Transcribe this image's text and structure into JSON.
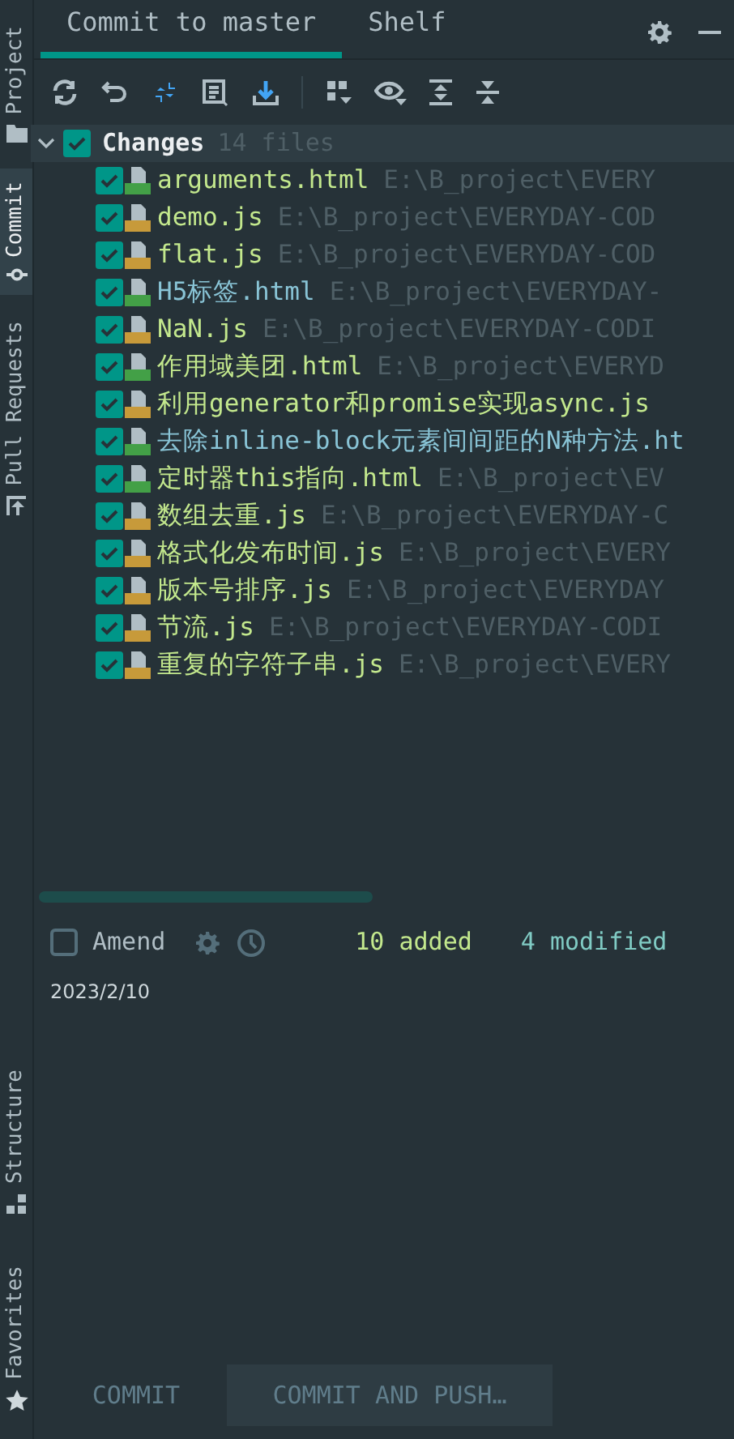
{
  "side_tabs": [
    {
      "label": "Project",
      "kind": "folder",
      "selected": false
    },
    {
      "label": "Commit",
      "kind": "commit",
      "selected": true
    },
    {
      "label": "Pull Requests",
      "kind": "pull",
      "selected": false
    }
  ],
  "side_tabs_bottom": [
    {
      "label": "Structure",
      "kind": "structure",
      "selected": false
    },
    {
      "label": "Favorites",
      "kind": "star",
      "selected": false
    }
  ],
  "tabs": [
    {
      "label": "Commit to master",
      "selected": true
    },
    {
      "label": "Shelf",
      "selected": false
    }
  ],
  "changes": {
    "label": "Changes",
    "count": "14 files",
    "checked": true,
    "expanded": true,
    "files": [
      {
        "name": "arguments.html",
        "path": "E:\\B_project\\EVERY",
        "kind": "html",
        "modified": false,
        "checked": true
      },
      {
        "name": "demo.js",
        "path": "E:\\B_project\\EVERYDAY-COD",
        "kind": "js",
        "modified": false,
        "checked": true
      },
      {
        "name": "flat.js",
        "path": "E:\\B_project\\EVERYDAY-COD",
        "kind": "js",
        "modified": false,
        "checked": true
      },
      {
        "name": "H5标签.html",
        "path": "E:\\B_project\\EVERYDAY-",
        "kind": "html",
        "modified": true,
        "checked": true
      },
      {
        "name": "NaN.js",
        "path": "E:\\B_project\\EVERYDAY-CODI",
        "kind": "js",
        "modified": false,
        "checked": true
      },
      {
        "name": "作用域美团.html",
        "path": "E:\\B_project\\EVERYD",
        "kind": "html",
        "modified": false,
        "checked": true
      },
      {
        "name": "利用generator和promise实现async.js",
        "kind": "js",
        "modified": false,
        "checked": true
      },
      {
        "name": "去除inline-block元素间间距的N种方法.ht",
        "kind": "html",
        "modified": true,
        "checked": true
      },
      {
        "name": "定时器this指向.html",
        "path": "E:\\B_project\\EV",
        "kind": "html",
        "modified": false,
        "checked": true
      },
      {
        "name": "数组去重.js",
        "path": "E:\\B_project\\EVERYDAY-C",
        "kind": "js",
        "modified": false,
        "checked": true
      },
      {
        "name": "格式化发布时间.js",
        "path": "E:\\B_project\\EVERY",
        "kind": "js",
        "modified": false,
        "checked": true
      },
      {
        "name": "版本号排序.js",
        "path": "E:\\B_project\\EVERYDAY",
        "kind": "js",
        "modified": false,
        "checked": true
      },
      {
        "name": "节流.js",
        "path": "E:\\B_project\\EVERYDAY-CODI",
        "kind": "js",
        "modified": false,
        "checked": true
      },
      {
        "name": "重复的字符子串.js",
        "path": "E:\\B_project\\EVERY",
        "kind": "js",
        "modified": false,
        "checked": true
      }
    ]
  },
  "amend": {
    "label": "Amend",
    "checked": false
  },
  "stats": {
    "added": "10 added",
    "modified": "4 modified"
  },
  "message": "2023/2/10",
  "buttons": [
    "COMMIT",
    "COMMIT AND PUSH…"
  ]
}
